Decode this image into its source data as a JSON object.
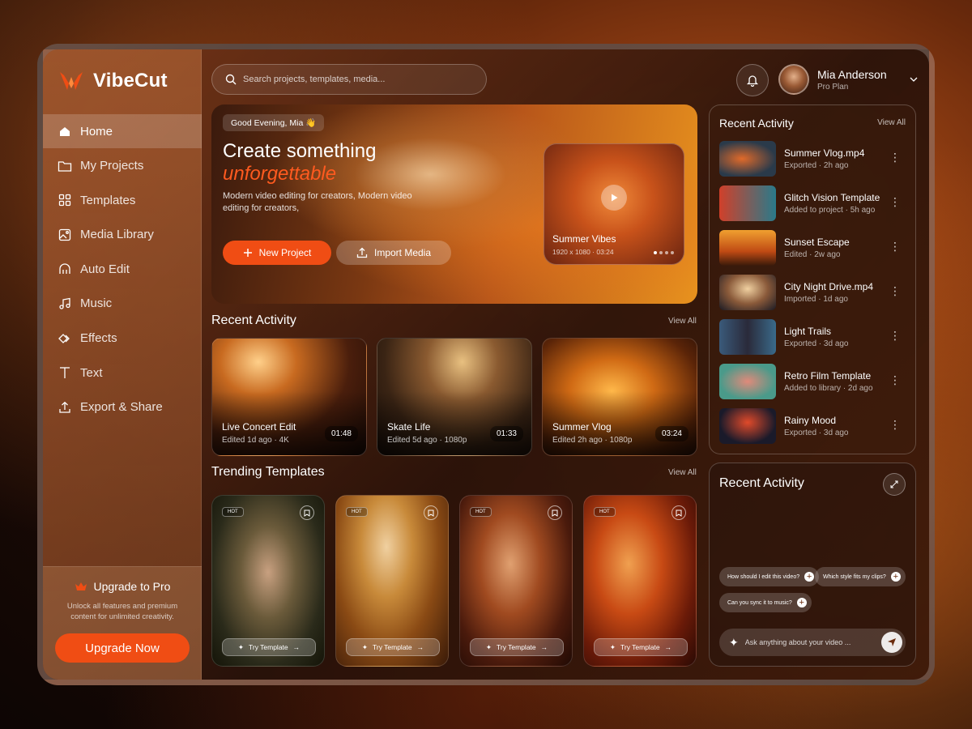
{
  "app": {
    "name": "VibeCut"
  },
  "colors": {
    "accent": "#f04d14",
    "accent_text": "#ff5a1f"
  },
  "sidebar": {
    "items": [
      {
        "label": "Home",
        "icon": "home-icon",
        "active": true
      },
      {
        "label": "My Projects",
        "icon": "folder-icon"
      },
      {
        "label": "Templates",
        "icon": "grid-icon"
      },
      {
        "label": "Media Library",
        "icon": "image-icon"
      },
      {
        "label": "Auto Edit",
        "icon": "robot-icon"
      },
      {
        "label": "Music",
        "icon": "music-icon"
      },
      {
        "label": "Effects",
        "icon": "effects-icon"
      },
      {
        "label": "Text",
        "icon": "text-icon"
      },
      {
        "label": "Export & Share",
        "icon": "upload-icon"
      }
    ],
    "upgrade": {
      "title": "Upgrade to Pro",
      "desc": "Unlock all features and premium content for unlimited creativity.",
      "button": "Upgrade Now"
    }
  },
  "search": {
    "placeholder": "Search projects, templates, media..."
  },
  "user": {
    "name": "Mia Anderson",
    "plan": "Pro Plan"
  },
  "hero": {
    "greeting": "Good Evening, Mia 👋",
    "title": "Create something",
    "accent": "unforgettable",
    "desc": "Modern video editing for creators, Modern video editing for creators,",
    "primary": "New Project",
    "secondary": "Import Media",
    "video": {
      "title": "Summer Vibes",
      "meta": "1920 x 1080 · 03:24"
    }
  },
  "recent": {
    "title": "Recent Activity",
    "view_all": "View All",
    "cards": [
      {
        "title": "Live Concert Edit",
        "meta": "Edited 1d ago · 4K",
        "duration": "01:48"
      },
      {
        "title": "Skate Life",
        "meta": "Edited 5d ago · 1080p",
        "duration": "01:33"
      },
      {
        "title": "Summer Vlog",
        "meta": "Edited 2h ago · 1080p",
        "duration": "03:24"
      }
    ]
  },
  "trending": {
    "title": "Trending Templates",
    "view_all": "View All",
    "hot": "HOT",
    "try_label": "Try Template"
  },
  "activity": {
    "title": "Recent Activity",
    "view_all": "View All",
    "items": [
      {
        "title": "Summer Vlog.mp4",
        "meta": "Exported · 2h ago"
      },
      {
        "title": "Glitch Vision Template",
        "meta": "Added to project · 5h ago"
      },
      {
        "title": "Sunset Escape",
        "meta": "Edited · 2w ago"
      },
      {
        "title": "City Night Drive.mp4",
        "meta": "Imported · 1d ago"
      },
      {
        "title": "Light Trails",
        "meta": "Exported · 3d ago"
      },
      {
        "title": "Retro Film Template",
        "meta": "Added to library · 2d ago"
      },
      {
        "title": "Rainy Mood",
        "meta": "Exported · 3d ago"
      }
    ]
  },
  "assistant": {
    "title": "Recent Activity",
    "chips": [
      "How should I edit this video?",
      "Which style fits my clips?",
      "Can you sync it to music?"
    ],
    "placeholder": "Ask anything about your video ..."
  }
}
